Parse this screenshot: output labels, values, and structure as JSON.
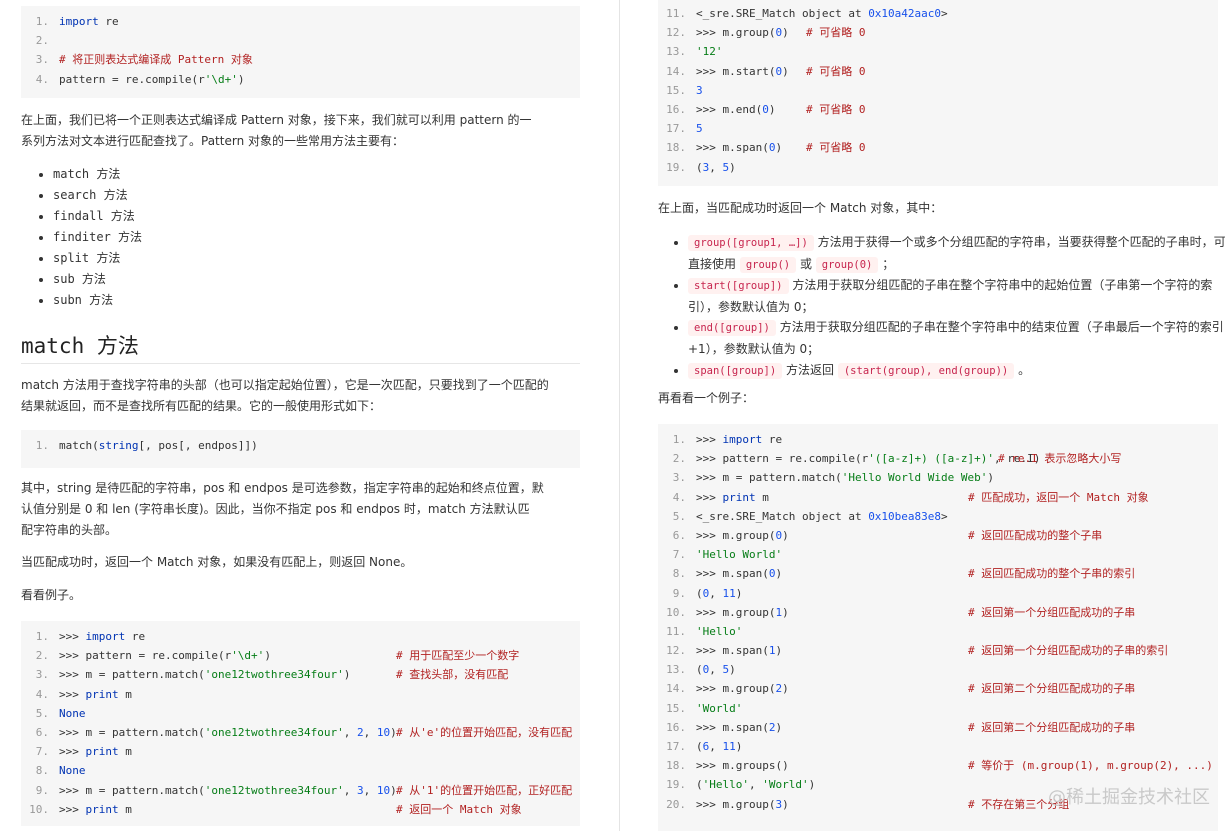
{
  "left": {
    "code1": [
      {
        "n": "1.",
        "parts": [
          [
            "k",
            "import"
          ],
          [
            "",
            "re"
          ]
        ]
      },
      {
        "n": "2.",
        "parts": []
      },
      {
        "n": "3.",
        "parts": [
          [
            "c",
            "# 将正则表达式编译成 Pattern 对象"
          ]
        ]
      },
      {
        "n": "4.",
        "parts": [
          [
            "",
            "pattern = re.compile(r"
          ],
          [
            "s",
            "'\\d+'"
          ],
          [
            "",
            ")"
          ]
        ]
      }
    ],
    "para1_line1": "在上面，我们已将一个正则表达式编译成 Pattern 对象，接下来，我们就可以利用 pattern 的一",
    "para1_line2": "系列方法对文本进行匹配查找了。Pattern 对象的一些常用方法主要有：",
    "methods": [
      "match 方法",
      "search 方法",
      "findall 方法",
      "finditer 方法",
      "split 方法",
      "sub 方法",
      "subn 方法"
    ],
    "heading": "match 方法",
    "para2_line1": "match 方法用于查找字符串的头部（也可以指定起始位置），它是一次匹配，只要找到了一个匹配的",
    "para2_line2": "结果就返回，而不是查找所有匹配的结果。它的一般使用形式如下：",
    "code2": [
      {
        "n": "1.",
        "parts": [
          [
            "",
            "match("
          ],
          [
            "k",
            "string"
          ],
          [
            "",
            "[, pos[, endpos]])"
          ]
        ]
      }
    ],
    "para3_line1": "其中，string 是待匹配的字符串，pos 和 endpos 是可选参数，指定字符串的起始和终点位置，默",
    "para3_line2": "认值分别是  0  和 len (字符串长度)。因此，当你不指定 pos 和 endpos 时，match 方法默认匹",
    "para3_line3": "配字符串的头部。",
    "para4": "当匹配成功时，返回一个  Match  对象，如果没有匹配上，则返回  None。",
    "para5": "看看例子。",
    "code3": [
      {
        "n": "1.",
        "parts": [
          [
            "",
            ">>> "
          ],
          [
            "k",
            "import"
          ],
          [
            "",
            "re"
          ]
        ],
        "cm": ""
      },
      {
        "n": "2.",
        "parts": [
          [
            "",
            ">>> pattern = re.compile(r"
          ],
          [
            "s",
            "'\\d+'"
          ],
          [
            "",
            ")"
          ]
        ],
        "cm": "# 用于匹配至少一个数字"
      },
      {
        "n": "3.",
        "parts": [
          [
            "",
            ">>> m = pattern.match("
          ],
          [
            "s",
            "'one12twothree34four'"
          ],
          [
            "",
            ")"
          ]
        ],
        "cm": "# 查找头部，没有匹配"
      },
      {
        "n": "4.",
        "parts": [
          [
            "",
            ">>> "
          ],
          [
            "k",
            "print"
          ],
          [
            "",
            "m"
          ]
        ],
        "cm": ""
      },
      {
        "n": "5.",
        "parts": [
          [
            "k",
            "None"
          ]
        ],
        "cm": ""
      },
      {
        "n": "6.",
        "parts": [
          [
            "",
            ">>> m = pattern.match("
          ],
          [
            "s",
            "'one12twothree34four'"
          ],
          [
            "",
            ", "
          ],
          [
            "n",
            "2"
          ],
          [
            "",
            ", "
          ],
          [
            "n",
            "10"
          ],
          [
            "",
            ")"
          ]
        ],
        "cm": "# 从'e'的位置开始匹配，没有匹配"
      },
      {
        "n": "7.",
        "parts": [
          [
            "",
            ">>> "
          ],
          [
            "k",
            "print"
          ],
          [
            "",
            "m"
          ]
        ],
        "cm": ""
      },
      {
        "n": "8.",
        "parts": [
          [
            "k",
            "None"
          ]
        ],
        "cm": ""
      },
      {
        "n": "9.",
        "parts": [
          [
            "",
            ">>> m = pattern.match("
          ],
          [
            "s",
            "'one12twothree34four'"
          ],
          [
            "",
            ", "
          ],
          [
            "n",
            "3"
          ],
          [
            "",
            ", "
          ],
          [
            "n",
            "10"
          ],
          [
            "",
            ")"
          ]
        ],
        "cm": "# 从'1'的位置开始匹配，正好匹配"
      },
      {
        "n": "10.",
        "parts": [
          [
            "",
            ">>> "
          ],
          [
            "k",
            "print"
          ],
          [
            "",
            "m"
          ]
        ],
        "cm": "# 返回一个 Match 对象"
      }
    ]
  },
  "right": {
    "code4": [
      {
        "n": "11.",
        "parts": [
          [
            "",
            "<_sre.SRE_Match object at "
          ],
          [
            "n",
            "0x10a42aac0"
          ],
          [
            "",
            ">"
          ]
        ],
        "cm": ""
      },
      {
        "n": "12.",
        "parts": [
          [
            "",
            ">>> m.group("
          ],
          [
            "n",
            "0"
          ],
          [
            "",
            ")"
          ]
        ],
        "cm": "# 可省略 0"
      },
      {
        "n": "13.",
        "parts": [
          [
            "s",
            "'12'"
          ]
        ],
        "cm": ""
      },
      {
        "n": "14.",
        "parts": [
          [
            "",
            ">>> m.start("
          ],
          [
            "n",
            "0"
          ],
          [
            "",
            ")"
          ]
        ],
        "cm": "# 可省略 0"
      },
      {
        "n": "15.",
        "parts": [
          [
            "n",
            "3"
          ]
        ],
        "cm": ""
      },
      {
        "n": "16.",
        "parts": [
          [
            "",
            ">>> m.end("
          ],
          [
            "n",
            "0"
          ],
          [
            "",
            ")"
          ]
        ],
        "cm": "# 可省略 0"
      },
      {
        "n": "17.",
        "parts": [
          [
            "n",
            "5"
          ]
        ],
        "cm": ""
      },
      {
        "n": "18.",
        "parts": [
          [
            "",
            ">>> m.span("
          ],
          [
            "n",
            "0"
          ],
          [
            "",
            ")"
          ]
        ],
        "cm": "# 可省略 0"
      },
      {
        "n": "19.",
        "parts": [
          [
            "",
            "("
          ],
          [
            "n",
            "3"
          ],
          [
            "",
            ", "
          ],
          [
            "n",
            "5"
          ],
          [
            "",
            ")"
          ]
        ],
        "cm": ""
      }
    ],
    "para1": "在上面，当匹配成功时返回一个  Match  对象，其中：",
    "bullets": [
      {
        "tag": "group([group1, …])",
        "text": "方法用于获得一个或多个分组匹配的字符串，当要获得整个匹配的子串时，可直接使用",
        "tag2": "group()",
        "mid": "或",
        "tag3": "group(0)",
        "end": "；"
      },
      {
        "tag": "start([group])",
        "text": "方法用于获取分组匹配的子串在整个字符串中的起始位置（子串第一个字符的索引），参数默认值为 0；"
      },
      {
        "tag": "end([group])",
        "text": "方法用于获取分组匹配的子串在整个字符串中的结束位置（子串最后一个字符的索引+1），参数默认值为 0；"
      },
      {
        "tag": "span([group])",
        "text": "方法返回",
        "tag2": "(start(group), end(group))",
        "end": "。"
      }
    ],
    "para2": "再看看一个例子：",
    "code5": [
      {
        "n": "1.",
        "parts": [
          [
            "",
            ">>> "
          ],
          [
            "k",
            "import"
          ],
          [
            "",
            "re"
          ]
        ],
        "cm": ""
      },
      {
        "n": "2.",
        "parts": [
          [
            "",
            ">>> pattern = re.compile(r"
          ],
          [
            "s",
            "'([a-z]+) ([a-z]+)'"
          ],
          [
            "",
            ", re.I)"
          ]
        ],
        "cm": "# re.I 表示忽略大小写",
        "cmx": "340"
      },
      {
        "n": "3.",
        "parts": [
          [
            "",
            ">>> m = pattern.match("
          ],
          [
            "s",
            "'Hello World Wide Web'"
          ],
          [
            "",
            ")"
          ]
        ],
        "cm": ""
      },
      {
        "n": "4.",
        "parts": [
          [
            "",
            ">>> "
          ],
          [
            "k",
            "print"
          ],
          [
            "",
            "m"
          ]
        ],
        "cm": "# 匹配成功，返回一个 Match 对象"
      },
      {
        "n": "5.",
        "parts": [
          [
            "",
            "<_sre.SRE_Match object at "
          ],
          [
            "n",
            "0x10bea83e8"
          ],
          [
            "",
            ">"
          ]
        ],
        "cm": ""
      },
      {
        "n": "6.",
        "parts": [
          [
            "",
            ">>> m.group("
          ],
          [
            "n",
            "0"
          ],
          [
            "",
            ")"
          ]
        ],
        "cm": "# 返回匹配成功的整个子串"
      },
      {
        "n": "7.",
        "parts": [
          [
            "s",
            "'Hello World'"
          ]
        ],
        "cm": ""
      },
      {
        "n": "8.",
        "parts": [
          [
            "",
            ">>> m.span("
          ],
          [
            "n",
            "0"
          ],
          [
            "",
            ")"
          ]
        ],
        "cm": "# 返回匹配成功的整个子串的索引"
      },
      {
        "n": "9.",
        "parts": [
          [
            "",
            "("
          ],
          [
            "n",
            "0"
          ],
          [
            "",
            ", "
          ],
          [
            "n",
            "11"
          ],
          [
            "",
            ")"
          ]
        ],
        "cm": ""
      },
      {
        "n": "10.",
        "parts": [
          [
            "",
            ">>> m.group("
          ],
          [
            "n",
            "1"
          ],
          [
            "",
            ")"
          ]
        ],
        "cm": "# 返回第一个分组匹配成功的子串"
      },
      {
        "n": "11.",
        "parts": [
          [
            "s",
            "'Hello'"
          ]
        ],
        "cm": ""
      },
      {
        "n": "12.",
        "parts": [
          [
            "",
            ">>> m.span("
          ],
          [
            "n",
            "1"
          ],
          [
            "",
            ")"
          ]
        ],
        "cm": "# 返回第一个分组匹配成功的子串的索引"
      },
      {
        "n": "13.",
        "parts": [
          [
            "",
            "("
          ],
          [
            "n",
            "0"
          ],
          [
            "",
            ", "
          ],
          [
            "n",
            "5"
          ],
          [
            "",
            ")"
          ]
        ],
        "cm": ""
      },
      {
        "n": "14.",
        "parts": [
          [
            "",
            ">>> m.group("
          ],
          [
            "n",
            "2"
          ],
          [
            "",
            ")"
          ]
        ],
        "cm": "# 返回第二个分组匹配成功的子串"
      },
      {
        "n": "15.",
        "parts": [
          [
            "s",
            "'World'"
          ]
        ],
        "cm": ""
      },
      {
        "n": "16.",
        "parts": [
          [
            "",
            ">>> m.span("
          ],
          [
            "n",
            "2"
          ],
          [
            "",
            ")"
          ]
        ],
        "cm": "# 返回第二个分组匹配成功的子串"
      },
      {
        "n": "17.",
        "parts": [
          [
            "",
            "("
          ],
          [
            "n",
            "6"
          ],
          [
            "",
            ", "
          ],
          [
            "n",
            "11"
          ],
          [
            "",
            ")"
          ]
        ],
        "cm": ""
      },
      {
        "n": "18.",
        "parts": [
          [
            "",
            ">>> m.groups()"
          ]
        ],
        "cm": "# 等价于 (m.group(1), m.group(2), ...)"
      },
      {
        "n": "19.",
        "parts": [
          [
            "",
            "("
          ],
          [
            "s",
            "'Hello'"
          ],
          [
            "",
            ", "
          ],
          [
            "s",
            "'World'"
          ],
          [
            "",
            ")"
          ]
        ],
        "cm": ""
      },
      {
        "n": "20.",
        "parts": [
          [
            "",
            ">>> m.group("
          ],
          [
            "n",
            "3"
          ],
          [
            "",
            ")"
          ]
        ],
        "cm": "# 不存在第三个分组"
      }
    ],
    "watermark": "@稀土掘金技术社区"
  }
}
